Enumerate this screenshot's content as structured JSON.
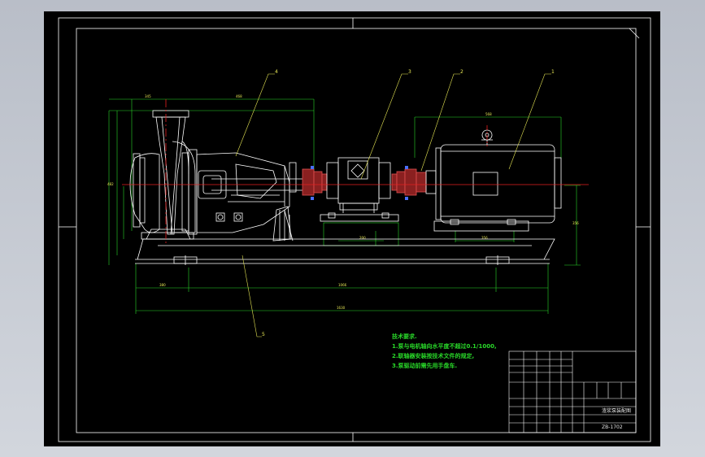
{
  "drawing": {
    "tech_requirements": {
      "heading": "技术要求.",
      "lines": [
        "1.泵与电机轴向水平度不超过0.1/1000,",
        "2.联轴器安装按技术文件的规定,",
        "3.泵驱动前需先用手盘车."
      ]
    },
    "balloons": [
      "4",
      "3",
      "2",
      "1",
      "5"
    ],
    "title_block": {
      "drawing_title": "渣浆泵装配图",
      "drawing_number": "ZB-1702"
    },
    "colors": {
      "background": "#000000",
      "frame": "#ffffff",
      "outline": "#ffffff",
      "center_line": "#e62020",
      "dimension": "#29d829",
      "leader": "#e8e855",
      "coupling": "#e05050"
    }
  }
}
